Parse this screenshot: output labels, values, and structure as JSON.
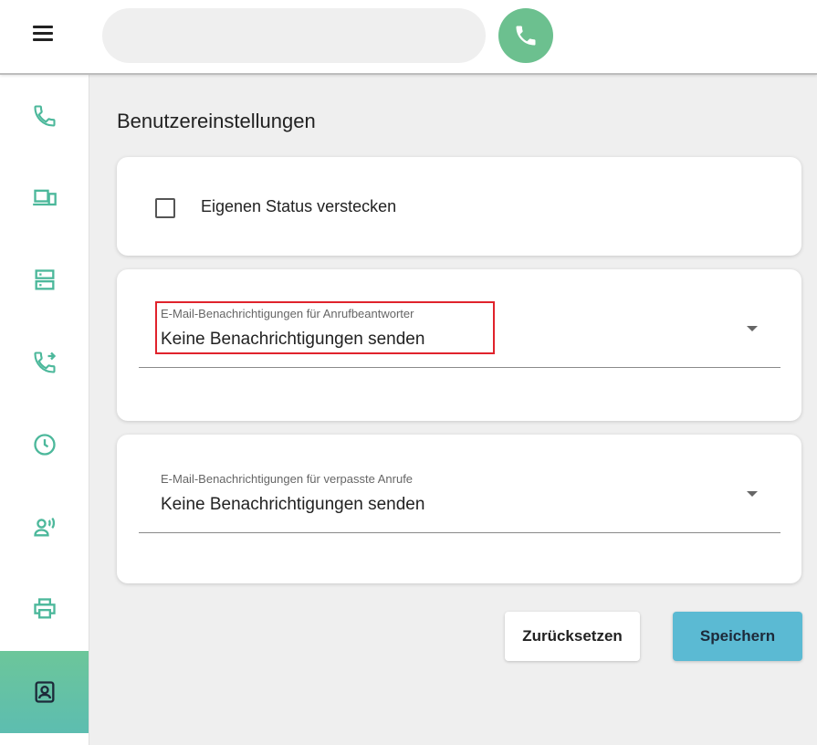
{
  "header": {
    "search_placeholder": "",
    "menu_icon": "hamburger-icon",
    "call_icon": "phone-icon",
    "call_color": "#6cc08f"
  },
  "sidebar": {
    "items": [
      {
        "icon": "phone-icon",
        "active": false
      },
      {
        "icon": "devices-icon",
        "active": false
      },
      {
        "icon": "server-icon",
        "active": false
      },
      {
        "icon": "call-forward-icon",
        "active": false
      },
      {
        "icon": "clock-icon",
        "active": false
      },
      {
        "icon": "user-voice-icon",
        "active": false
      },
      {
        "icon": "printer-icon",
        "active": false
      },
      {
        "icon": "contact-card-icon",
        "active": true
      }
    ],
    "accent_color": "#5cb9a0"
  },
  "main": {
    "title": "Benutzereinstellungen",
    "status_card": {
      "checkbox_label": "Eigenen Status verstecken",
      "checked": false
    },
    "voicemail_select": {
      "label": "E-Mail-Benachrichtigungen für Anrufbeantworter",
      "value": "Keine Benachrichtigungen senden",
      "highlighted": true
    },
    "missed_calls_select": {
      "label": "E-Mail-Benachrichtigungen für verpasste Anrufe",
      "value": "Keine Benachrichtigungen senden"
    },
    "buttons": {
      "reset_label": "Zurücksetzen",
      "save_label": "Speichern",
      "save_color": "#5bbad3"
    }
  }
}
